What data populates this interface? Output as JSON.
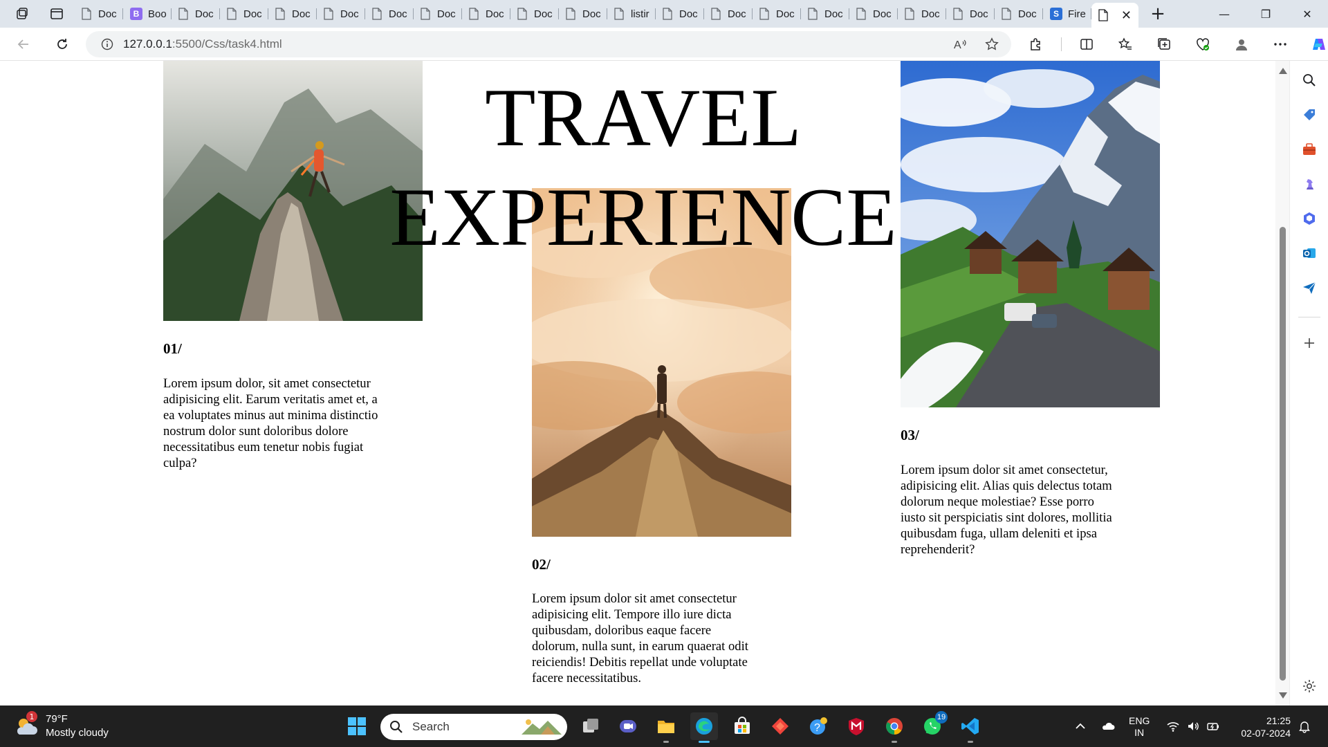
{
  "browser": {
    "tabs": [
      {
        "label": "Doc",
        "icon": "page-icon"
      },
      {
        "label": "Boo",
        "icon": "bootstrap-favicon",
        "favicon_letter": "B"
      },
      {
        "label": "Doc",
        "icon": "page-icon"
      },
      {
        "label": "Doc",
        "icon": "page-icon"
      },
      {
        "label": "Doc",
        "icon": "page-icon"
      },
      {
        "label": "Doc",
        "icon": "page-icon"
      },
      {
        "label": "Doc",
        "icon": "page-icon"
      },
      {
        "label": "Doc",
        "icon": "page-icon"
      },
      {
        "label": "Doc",
        "icon": "page-icon"
      },
      {
        "label": "Doc",
        "icon": "page-icon"
      },
      {
        "label": "Doc",
        "icon": "page-icon"
      },
      {
        "label": "listir",
        "icon": "page-icon"
      },
      {
        "label": "Doc",
        "icon": "page-icon"
      },
      {
        "label": "Doc",
        "icon": "page-icon"
      },
      {
        "label": "Doc",
        "icon": "page-icon"
      },
      {
        "label": "Doc",
        "icon": "page-icon"
      },
      {
        "label": "Doc",
        "icon": "page-icon"
      },
      {
        "label": "Doc",
        "icon": "page-icon"
      },
      {
        "label": "Doc",
        "icon": "page-icon"
      },
      {
        "label": "Doc",
        "icon": "page-icon"
      },
      {
        "label": "Fire",
        "icon": "stackblitz-favicon",
        "favicon_letter": "S"
      }
    ],
    "active_tab": {
      "label": "",
      "icon": "page-icon",
      "close": "✕"
    },
    "new_tab": "+",
    "window_controls": {
      "minimize": "—",
      "maximize": "❐",
      "close": "✕"
    },
    "address": {
      "host": "127.0.0.1",
      "path": ":5500/Css/task4.html"
    },
    "read_aloud_label": "A",
    "accent_color": "#0f6cbd"
  },
  "page": {
    "title_line1": "TRAVEL",
    "title_line2": "EXPERIENCE",
    "cards": [
      {
        "number": "01/",
        "image": "mountain-ridge-hiker-photo",
        "text": "Lorem ipsum dolor, sit amet consectetur adipisicing elit. Earum veritatis amet et, a ea voluptates minus aut minima distinctio nostrum dolor sunt doloribus dolore necessitatibus eum tenetur nobis fugiat culpa?"
      },
      {
        "number": "02/",
        "image": "sea-of-clouds-summit-photo",
        "text": "Lorem ipsum dolor sit amet consectetur adipisicing elit. Tempore illo iure dicta quibusdam, doloribus eaque facere dolorum, nulla sunt, in earum quaerat odit reiciendis! Debitis repellat unde voluptate facere necessitatibus."
      },
      {
        "number": "03/",
        "image": "alpine-village-photo",
        "text": "Lorem ipsum dolor sit amet consectetur, adipisicing elit. Alias quis delectus totam dolorum neque molestiae? Esse porro iusto sit perspiciatis sint dolores, mollitia quibusdam fuga, ullam deleniti et ipsa reprehenderit?"
      }
    ]
  },
  "taskbar": {
    "weather": {
      "temp": "79°F",
      "condition": "Mostly cloudy",
      "badge": "1"
    },
    "search_placeholder": "Search",
    "whatsapp_badge": "19",
    "language": {
      "line1": "ENG",
      "line2": "IN"
    },
    "clock": {
      "time": "21:25",
      "date": "02-07-2024"
    }
  }
}
